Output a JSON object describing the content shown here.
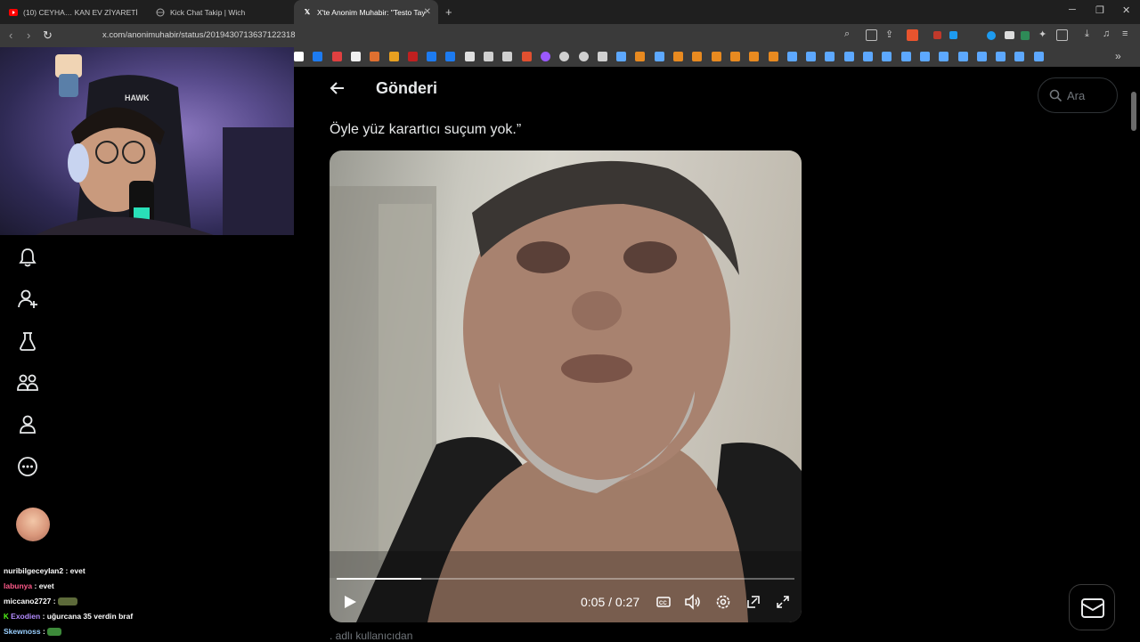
{
  "browser": {
    "tabs": [
      {
        "label": "(10) CEYHA… KAN EV ZİYARETİ",
        "icon": "youtube-icon"
      },
      {
        "label": "Kick Chat Takip | Wich",
        "icon": "globe-icon"
      },
      {
        "label": "X'te Anonim Muhabir: \"Testo Tay",
        "icon": "x-icon",
        "active": true
      }
    ],
    "new_tab": "+",
    "url": "x.com/anonimuhabir/status/2019430713637122318"
  },
  "page": {
    "title": "Gönderi",
    "search_placeholder": "Ara",
    "tweet_text": "Öyle yüz karartıcı suçum yok.”",
    "below_video_text": ". adlı kullanıcıdan"
  },
  "video": {
    "time": "0:05 / 0:27",
    "progress": 0.185,
    "controls": [
      "play-icon",
      "captions-icon",
      "volume-icon",
      "settings-icon",
      "pip-icon",
      "fullscreen-icon"
    ]
  },
  "sidebar": {
    "icons": [
      "bell-icon",
      "add-user-icon",
      "flask-icon",
      "communities-icon",
      "profile-icon",
      "more-icon"
    ]
  },
  "chat": [
    {
      "user": "nuribilgeceylan2",
      "message": ": evet",
      "color": "#ffffff"
    },
    {
      "user": "labunya",
      "message": ": evet",
      "color": "#ff5a8a"
    },
    {
      "user": "miccano2727",
      "message": ":",
      "color": "#ffffff",
      "emote": true
    },
    {
      "user": "Exodien",
      "message": ": uğurcana 35 verdin braf",
      "color": "#b48cff",
      "badge": "K"
    },
    {
      "user": "Skewnoss",
      "message": ":",
      "color": "#9ad0ff",
      "emote": true
    }
  ],
  "colors": {
    "accent": "#1d9bf0",
    "background": "#000000",
    "text": "#e7e9ea",
    "muted": "#71767b"
  }
}
